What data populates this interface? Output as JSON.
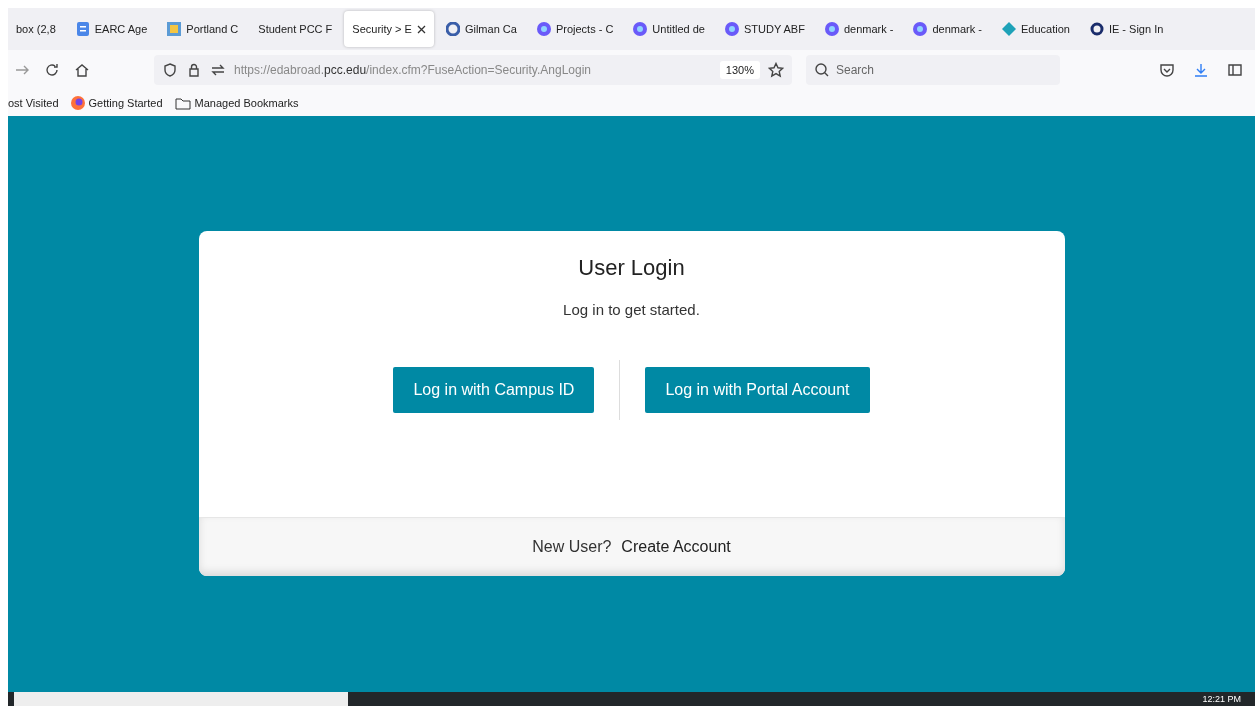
{
  "tabs": [
    {
      "label": "box (2,8",
      "selected": false,
      "kind": "plain"
    },
    {
      "label": "EARC Age",
      "selected": false,
      "kind": "doc"
    },
    {
      "label": "Portland C",
      "selected": false,
      "kind": "sheet"
    },
    {
      "label": "Student PCC F",
      "selected": false,
      "kind": "plain"
    },
    {
      "label": "Security > E",
      "selected": true,
      "kind": "plain"
    },
    {
      "label": "Gilman Ca",
      "selected": false,
      "kind": "g"
    },
    {
      "label": "Projects - C",
      "selected": false,
      "kind": "globe"
    },
    {
      "label": "Untitled de",
      "selected": false,
      "kind": "globe"
    },
    {
      "label": "STUDY ABF",
      "selected": false,
      "kind": "globe"
    },
    {
      "label": "denmark -",
      "selected": false,
      "kind": "globe"
    },
    {
      "label": "denmark -",
      "selected": false,
      "kind": "globe"
    },
    {
      "label": "Education",
      "selected": false,
      "kind": "diamond"
    },
    {
      "label": "IE - Sign In",
      "selected": false,
      "kind": "ring"
    }
  ],
  "toolbar": {
    "url_prefix": "https://edabroad.",
    "url_domain": "pcc.edu",
    "url_suffix": "/index.cfm?FuseAction=Security.AngLogin",
    "zoom": "130%",
    "search_placeholder": "Search"
  },
  "bookmarks": [
    {
      "label": "ost Visited",
      "kind": "plain"
    },
    {
      "label": "Getting Started",
      "kind": "firefox"
    },
    {
      "label": "Managed Bookmarks",
      "kind": "folder"
    }
  ],
  "login": {
    "title": "User Login",
    "subtitle": "Log in to get started.",
    "buttons": [
      "Log in with Campus ID",
      "Log in with Portal Account"
    ],
    "footer_prompt": "New User?",
    "footer_link": "Create Account"
  },
  "taskbar": {
    "time": "12:21 PM"
  }
}
